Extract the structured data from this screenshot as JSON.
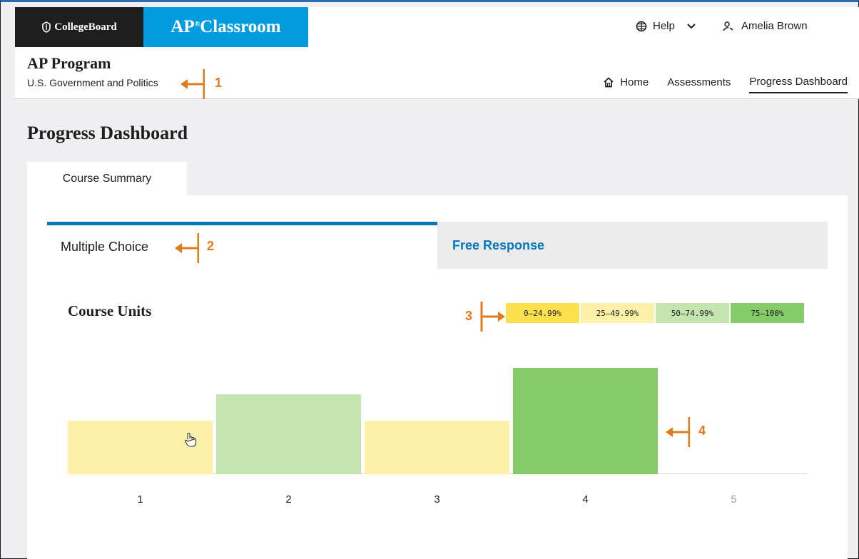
{
  "header": {
    "collegeboard_logo": "CollegeBoard",
    "ap_logo_main": "AP",
    "ap_logo_sup": "®",
    "ap_logo_rest": "Classroom",
    "help_label": "Help",
    "user_name": "Amelia Brown"
  },
  "program": {
    "title": "AP Program",
    "course": "U.S. Government and Politics"
  },
  "nav": {
    "home": "Home",
    "assessments": "Assessments",
    "progress_dashboard": "Progress Dashboard"
  },
  "page": {
    "title": "Progress Dashboard",
    "tab_course_summary": "Course Summary"
  },
  "subtabs": {
    "multiple_choice": "Multiple Choice",
    "free_response": "Free Response"
  },
  "chart": {
    "title": "Course Units",
    "legend": [
      {
        "label": "0–24.99%",
        "color": "#fce04e"
      },
      {
        "label": "25–49.99%",
        "color": "#fdf0a8"
      },
      {
        "label": "50–74.99%",
        "color": "#c4e5b0"
      },
      {
        "label": "75–100%",
        "color": "#86cb6a"
      }
    ]
  },
  "chart_data": {
    "type": "bar",
    "categories": [
      "1",
      "2",
      "3",
      "4",
      "5"
    ],
    "values": [
      2,
      3,
      2,
      4,
      0
    ],
    "colors": [
      "#fdf0a8",
      "#c4e5b0",
      "#fdf0a8",
      "#86cb6a",
      null
    ],
    "title": "Course Units",
    "xlabel": "",
    "ylabel": "",
    "ylim": [
      0,
      4
    ]
  },
  "annotations": [
    "1",
    "2",
    "3",
    "4"
  ],
  "colors": {
    "accent": "#0677ba",
    "ap_blue": "#009cde",
    "annotation": "#e07b1a"
  }
}
